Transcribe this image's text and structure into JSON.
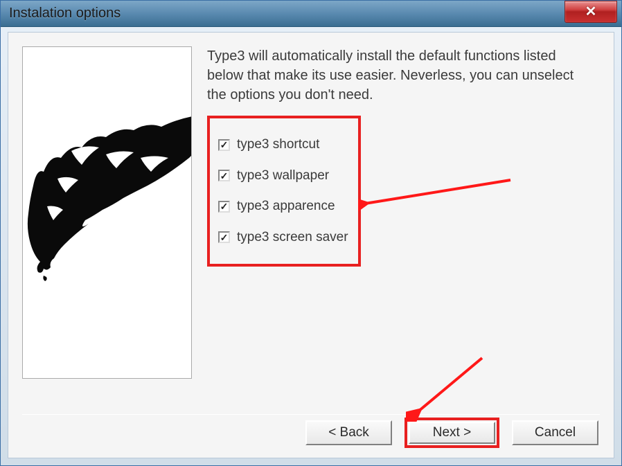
{
  "window": {
    "title": "Instalation options"
  },
  "content": {
    "description": "Type3 will automatically install the default functions listed below that make its use easier. Neverless, you can unselect the options you don't need.",
    "options": [
      {
        "label": "type3 shortcut",
        "checked": true
      },
      {
        "label": "type3 wallpaper",
        "checked": true
      },
      {
        "label": "type3 apparence",
        "checked": true
      },
      {
        "label": "type3 screen saver",
        "checked": true
      }
    ]
  },
  "buttons": {
    "back": "< Back",
    "next": "Next >",
    "cancel": "Cancel"
  }
}
